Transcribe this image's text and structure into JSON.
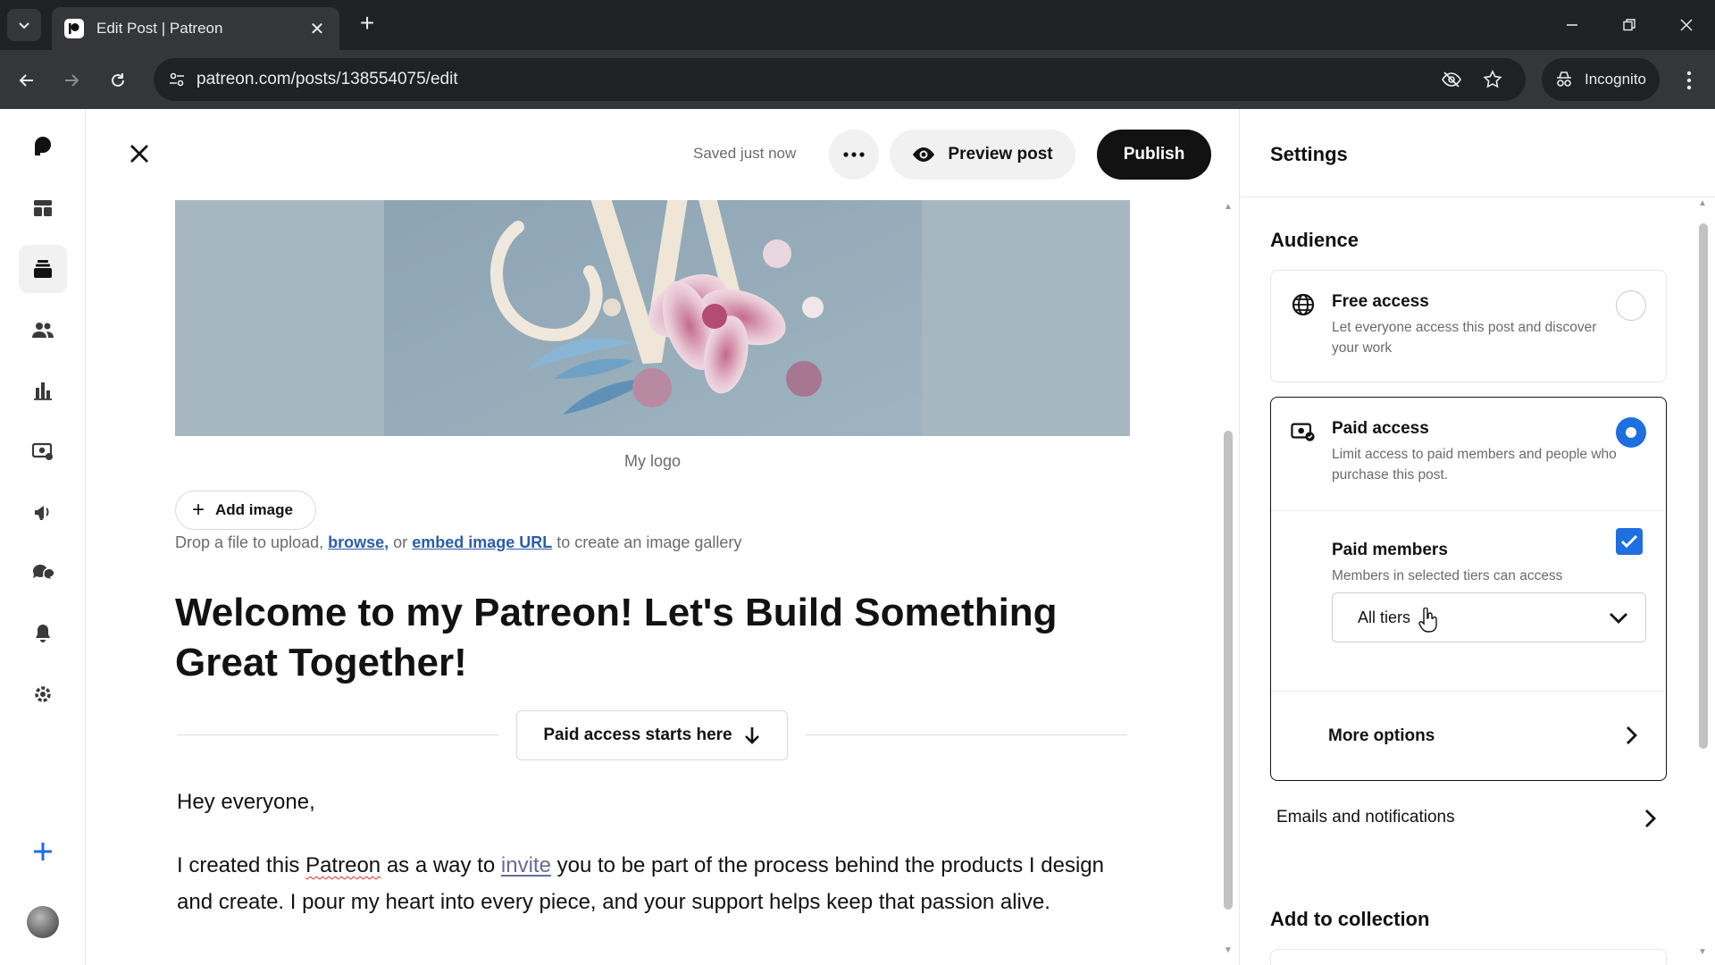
{
  "browser": {
    "tab_title": "Edit Post | Patreon",
    "url": "patreon.com/posts/138554075/edit",
    "incognito_label": "Incognito"
  },
  "editor": {
    "saved_status": "Saved just now",
    "preview_label": "Preview post",
    "publish_label": "Publish",
    "image_caption": "My logo",
    "add_image_label": "Add image",
    "drop_hint": {
      "prefix": "Drop a file to upload,",
      "browse": "browse,",
      "middle": "or",
      "embed": "embed image URL",
      "suffix": "to create an image gallery"
    },
    "title": "Welcome to my Patreon! Let's Build Something Great Together!",
    "paywall_label": "Paid access starts here",
    "greeting": "Hey everyone,",
    "paragraph": {
      "p1": "I created this",
      "patreon": "Patreon",
      "p2": "as a way to",
      "invite": "invite",
      "p3": "you to be part of the process behind the products I design and create. I pour my heart into every piece, and your support helps keep that passion alive."
    }
  },
  "settings": {
    "title": "Settings",
    "audience_title": "Audience",
    "free_access": {
      "title": "Free access",
      "description": "Let everyone access this post and discover your work",
      "selected": false
    },
    "paid_access": {
      "title": "Paid access",
      "description": "Limit access to paid members and people who purchase this post.",
      "selected": true
    },
    "paid_members": {
      "title": "Paid members",
      "description": "Members in selected tiers can access",
      "checked": true,
      "tier_select_value": "All tiers"
    },
    "more_options_label": "More options",
    "emails_label": "Emails and notifications",
    "collection_title": "Add to collection"
  },
  "colors": {
    "accent": "#1e6fe0",
    "publish_bg": "#121212",
    "chrome_dark": "#202124",
    "chrome_mid": "#35363a"
  },
  "icons": {
    "nav": [
      "patreon-logo-icon",
      "dashboard-icon",
      "library-icon",
      "audience-icon",
      "insights-icon",
      "payouts-icon",
      "promotions-icon",
      "chats-icon",
      "notifications-icon",
      "settings-icon",
      "create-plus-icon"
    ]
  }
}
